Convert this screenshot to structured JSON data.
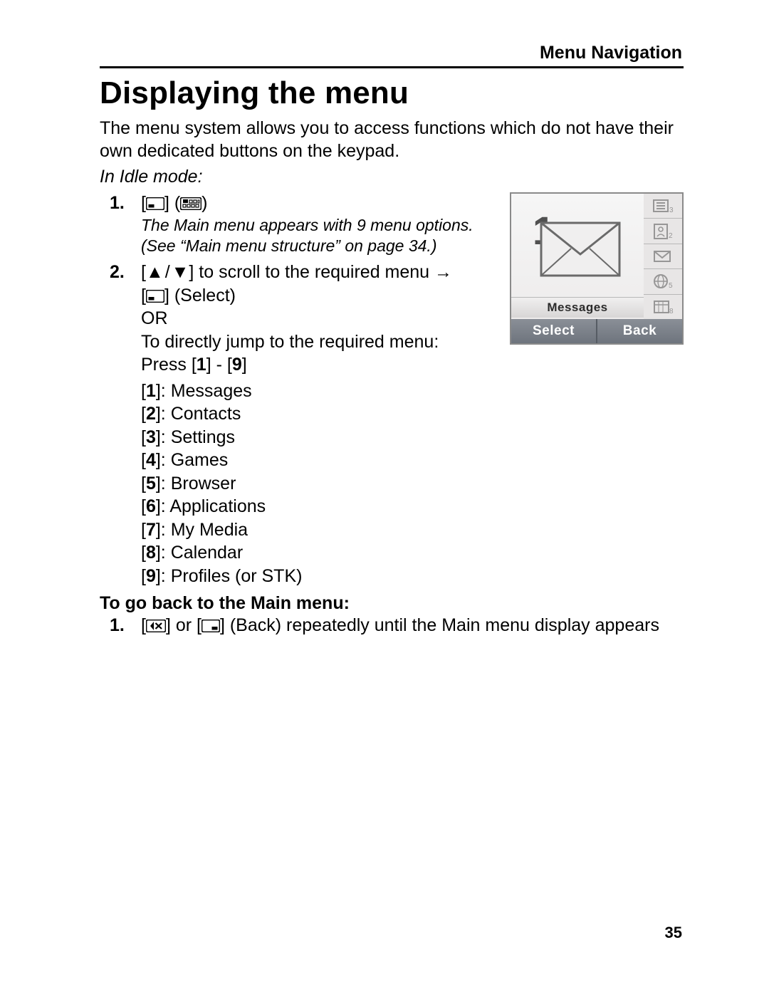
{
  "section_label": "Menu Navigation",
  "title": "Displaying the menu",
  "intro": "The menu system allows you to access functions which do not have their own dedicated buttons on the keypad.",
  "idle_mode_label": "In Idle mode:",
  "step1_note_line1": "The Main menu appears with 9 menu options.",
  "step1_note_line2": "(See “Main menu structure” on page 34.)",
  "step2_scroll_tail": "] to scroll to the required menu ",
  "step2_select_tail": "] (Select)",
  "step2_or": "OR",
  "step2_jump": "To directly jump to the required menu:",
  "step2_press_prefix": "Press [",
  "step2_press_range_sep": "] - [",
  "step2_press_close": "]",
  "menu_items": [
    {
      "key": "1",
      "name": "Messages"
    },
    {
      "key": "2",
      "name": "Contacts"
    },
    {
      "key": "3",
      "name": "Settings"
    },
    {
      "key": "4",
      "name": "Games"
    },
    {
      "key": "5",
      "name": "Browser"
    },
    {
      "key": "6",
      "name": "Applications"
    },
    {
      "key": "7",
      "name": "My Media"
    },
    {
      "key": "8",
      "name": "Calendar"
    },
    {
      "key": "9",
      "name": "Profiles (or STK)"
    }
  ],
  "go_back_heading": "To go back to the Main menu:",
  "go_back_or": "] or [",
  "go_back_tail": "] (Back) repeatedly until the Main menu display appears",
  "phone": {
    "highlight_label": "Messages",
    "softkey_left": "Select",
    "softkey_right": "Back"
  },
  "page_number": "35"
}
